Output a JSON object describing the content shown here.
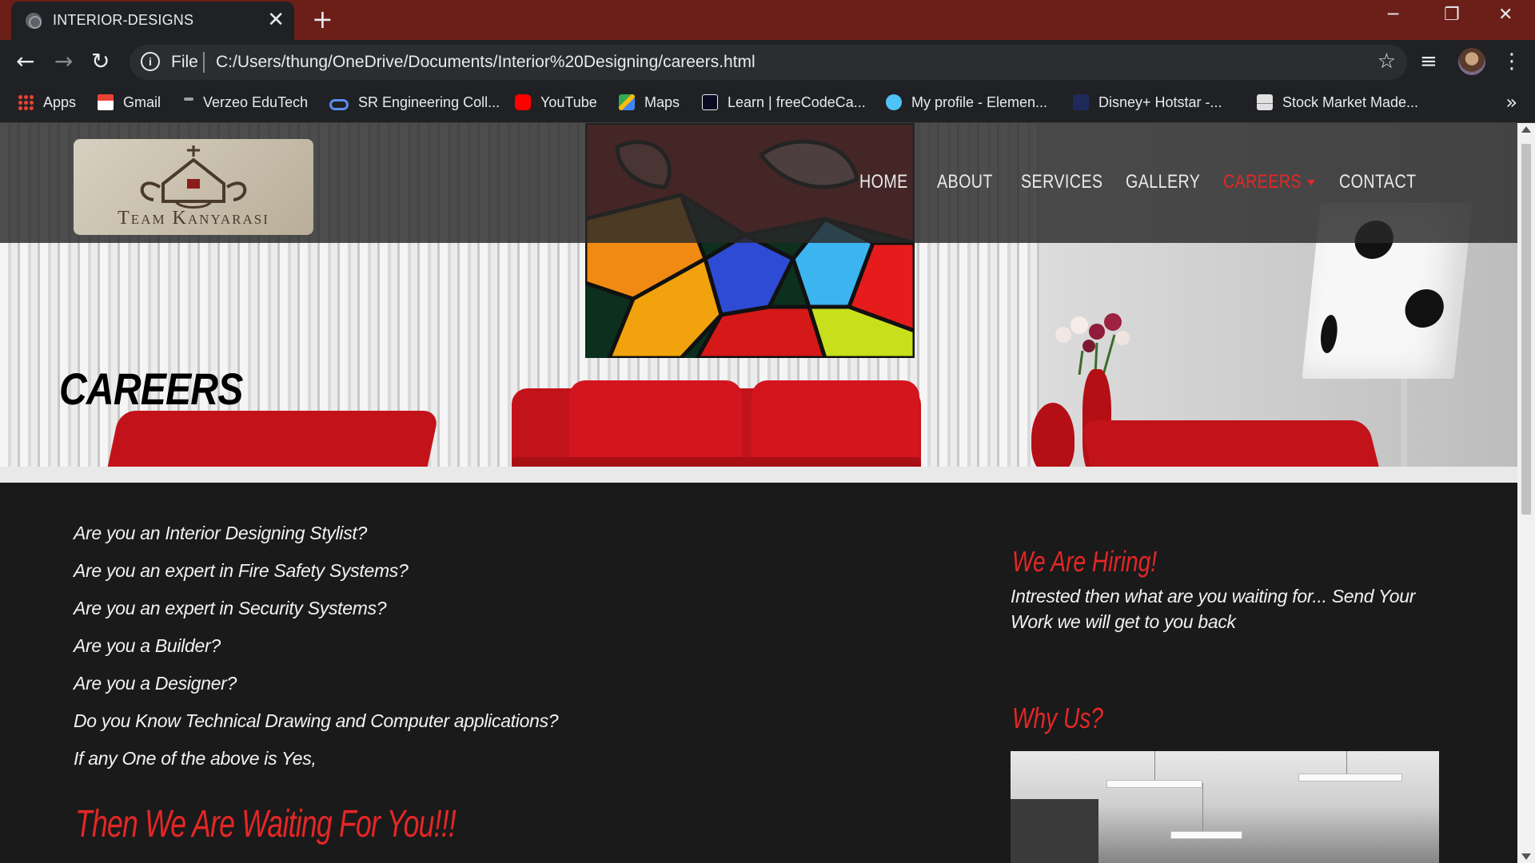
{
  "browser": {
    "tab_title": "INTERIOR-DESIGNS",
    "tab_close": "✕",
    "new_tab": "+",
    "window_controls": {
      "minimize": "─",
      "restore": "❐",
      "close": "✕"
    },
    "nav": {
      "back": "←",
      "forward": "→",
      "reload": "↻"
    },
    "omnibox": {
      "info_icon": "i",
      "scheme_label": "File",
      "url": "C:/Users/thung/OneDrive/Documents/Interior%20Designing/careers.html",
      "star": "☆"
    },
    "toolbar_icons": {
      "media": "≡",
      "menu": "⋮"
    },
    "bookmarks": [
      {
        "label": "Apps",
        "icon": "apps-grid-icon",
        "color": "#4285f4"
      },
      {
        "label": "Gmail",
        "icon": "gmail-icon",
        "color": "#ea4335"
      },
      {
        "label": "Verzeo EduTech",
        "icon": "verzeo-icon",
        "color": "#9aa0a6"
      },
      {
        "label": "SR Engineering Coll...",
        "icon": "sr-infinity-icon",
        "color": "#5b8def"
      },
      {
        "label": "YouTube",
        "icon": "youtube-icon",
        "color": "#ff0000"
      },
      {
        "label": "Maps",
        "icon": "maps-icon",
        "color": "#34a853"
      },
      {
        "label": "Learn | freeCodeCa...",
        "icon": "freecodecamp-icon",
        "color": "#0a0a23"
      },
      {
        "label": "My profile - Elemen...",
        "icon": "element-icon",
        "color": "#4fc3f7"
      },
      {
        "label": "Disney+ Hotstar -...",
        "icon": "hotstar-icon",
        "color": "#1f2a5a"
      },
      {
        "label": "Stock Market Made...",
        "icon": "stock-chart-icon",
        "color": "#e0e0e0"
      }
    ],
    "bookmarks_more": "»"
  },
  "site": {
    "logo_text": "Team Kanyarasi",
    "menu": [
      {
        "label": "HOME",
        "active": false
      },
      {
        "label": "ABOUT",
        "active": false
      },
      {
        "label": "SERVICES",
        "active": false
      },
      {
        "label": "GALLERY",
        "active": false
      },
      {
        "label": "CAREERS",
        "active": true
      },
      {
        "label": "CONTACT",
        "active": false
      }
    ],
    "hero_title": "CAREERS",
    "questions": [
      "Are you an Interior Designing Stylist?",
      "Are you an expert in Fire Safety Systems?",
      "Are you an expert in Security Systems?",
      "Are you a Builder?",
      "Are you a Designer?",
      "Do you Know Technical Drawing and Computer applications?",
      "If any One of the above is Yes,"
    ],
    "cta": "Then We Are Waiting For You!!!",
    "hiring_heading": "We Are Hiring!",
    "hiring_text": "Intrested then what are you waiting for... Send Your Work we will get to you back",
    "why_heading": "Why Us?",
    "colors": {
      "accent": "#e52626",
      "background": "#1a1a1a",
      "browser_frame": "#6b1f18"
    }
  }
}
